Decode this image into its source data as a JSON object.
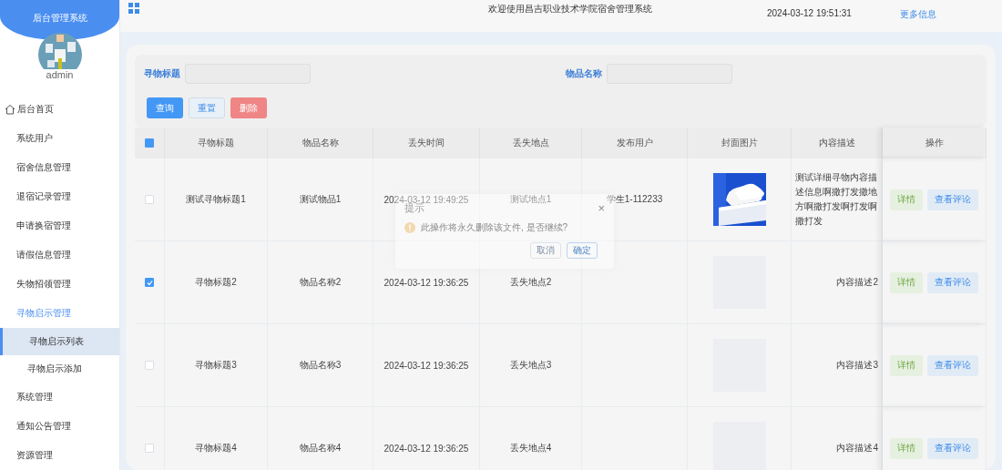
{
  "sidebar": {
    "title": "后台管理系统",
    "user": "admin",
    "items": [
      {
        "label": "后台首页",
        "selected": false
      },
      {
        "label": "系统用户",
        "selected": false
      },
      {
        "label": "宿舍信息管理",
        "selected": false
      },
      {
        "label": "退宿记录管理",
        "selected": false
      },
      {
        "label": "申请换宿管理",
        "selected": false
      },
      {
        "label": "请假信息管理",
        "selected": false
      },
      {
        "label": "失物招领管理",
        "selected": false
      },
      {
        "label": "寻物启示管理",
        "selected": false,
        "expanded": true,
        "children": [
          {
            "label": "寻物启示列表",
            "selected": true
          },
          {
            "label": "寻物启示添加",
            "selected": false
          }
        ]
      },
      {
        "label": "系统管理",
        "selected": false
      },
      {
        "label": "通知公告管理",
        "selected": false
      },
      {
        "label": "资源管理",
        "selected": false
      }
    ]
  },
  "header": {
    "welcome": "欢迎使用昌吉职业技术学院宿舍管理系统",
    "datetime": "2024-03-12 19:51:31",
    "more_link": "更多信息"
  },
  "search": {
    "fields": [
      {
        "label": "寻物标题"
      },
      {
        "label": "物品名称"
      }
    ],
    "buttons": [
      {
        "label": "查询",
        "kind": "primary"
      },
      {
        "label": "重置",
        "kind": "default"
      },
      {
        "label": "删除",
        "kind": "danger"
      }
    ]
  },
  "table": {
    "header_checkbox": {
      "indeterminate": true
    },
    "columns": [
      "寻物标题",
      "物品名称",
      "丢失时间",
      "丢失地点",
      "发布用户",
      "封面图片",
      "内容描述",
      "操作"
    ],
    "rows": [
      {
        "checked": false,
        "title": "测试寻物标题1",
        "name": "测试物品1",
        "time": "2024-03-12 19:49:25",
        "place": "测试地点1",
        "user": "学生1-112233",
        "image": {
          "kind": "picture"
        },
        "description": "测试详细寻物内容描述信息啊撒打发撒地方啊撒打发啊打发啊撒打发",
        "actions": [
          "详情",
          "查看评论"
        ]
      },
      {
        "checked": true,
        "title": "寻物标题2",
        "name": "物品名称2",
        "time": "2024-03-12 19:36:25",
        "place": "丢失地点2",
        "image": {
          "kind": "empty"
        },
        "description": "内容描述2",
        "actions": [
          "详情",
          "查看评论"
        ]
      },
      {
        "checked": false,
        "title": "寻物标题3",
        "name": "物品名称3",
        "time": "2024-03-12 19:36:25",
        "place": "丢失地点3",
        "image": {
          "kind": "empty"
        },
        "description": "内容描述3",
        "actions": [
          "详情",
          "查看评论"
        ]
      },
      {
        "checked": false,
        "title": "寻物标题4",
        "name": "物品名称4",
        "time": "2024-03-12 19:36:25",
        "place": "丢失地点4",
        "image": {
          "kind": "empty"
        },
        "description": "内容描述4",
        "actions": [
          "详情",
          "查看评论"
        ]
      }
    ]
  },
  "dialog": {
    "title": "提示",
    "close": "×",
    "message": "此操作将永久删除该文件, 是否继续?",
    "buttons": [
      {
        "label": "取消",
        "kind": "default"
      },
      {
        "label": "确定",
        "kind": "primary"
      }
    ]
  }
}
